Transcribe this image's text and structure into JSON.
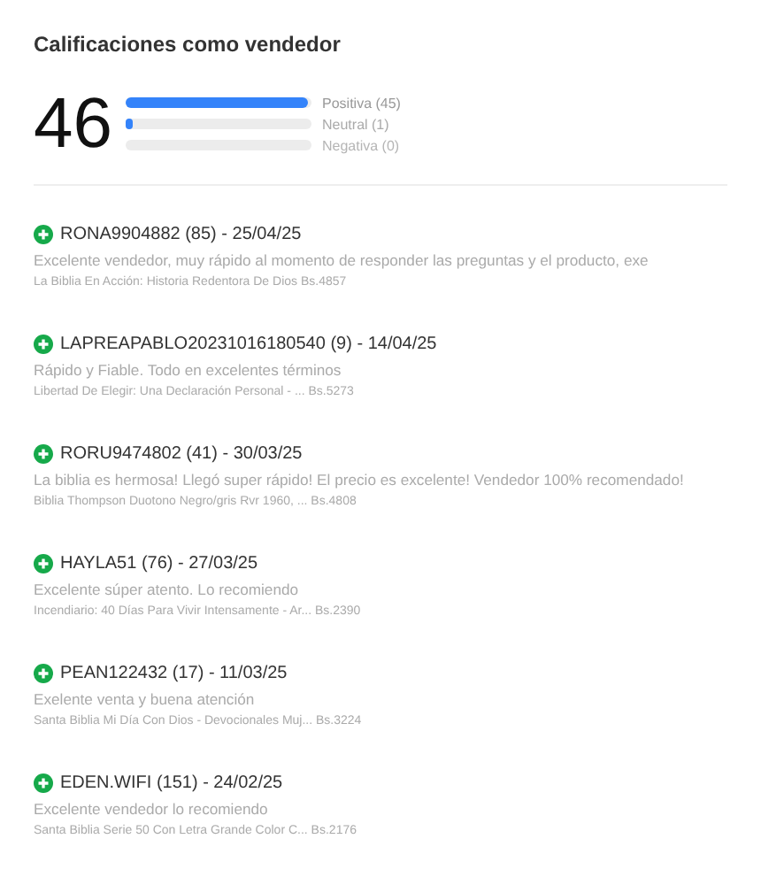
{
  "title": "Calificaciones como vendedor",
  "summary": {
    "total": "46",
    "bars": [
      {
        "label": "Positiva (45)",
        "level": 0.98,
        "kind": "positive"
      },
      {
        "label": "Neutral (1)",
        "level": 0.04,
        "kind": "neutral"
      },
      {
        "label": "Negativa (0)",
        "kind": "negative"
      }
    ]
  },
  "ratings": [
    {
      "kind": "positive",
      "header": "RONA9904882 (85) - 25/04/25",
      "comment": "Excelente vendedor, muy rápido al momento de responder las preguntas y el producto, exe",
      "product": "La Biblia En Acción: Historia Redentora De Dios Bs.4857"
    },
    {
      "kind": "positive",
      "header": "LAPREAPABLO20231016180540 (9) - 14/04/25",
      "comment": "Rápido y Fiable. Todo en excelentes términos",
      "product": "Libertad De Elegir: Una Declaración Personal - ...  Bs.5273"
    },
    {
      "kind": "positive",
      "header": "RORU9474802 (41) - 30/03/25",
      "comment": "La biblia es hermosa! Llegó super rápido! El precio es excelente! Vendedor 100% recomendado!",
      "product": "Biblia Thompson Duotono Negro/gris Rvr 1960, ...  Bs.4808"
    },
    {
      "kind": "positive",
      "header": "HAYLA51 (76) - 27/03/25",
      "comment": "Excelente súper atento. Lo recomiendo",
      "product": "Incendiario: 40 Días Para Vivir Intensamente - Ar... Bs.2390"
    },
    {
      "kind": "positive",
      "header": "PEAN122432 (17) - 11/03/25",
      "comment": "Exelente venta y buena atención",
      "product": "Santa Biblia Mi Día Con Dios - Devocionales Muj... Bs.3224"
    },
    {
      "kind": "positive",
      "header": "EDEN.WIFI (151) - 24/02/25",
      "comment": "Excelente vendedor lo recomiendo",
      "product": "Santa Biblia Serie 50 Con Letra Grande Color C...  Bs.2176"
    }
  ]
}
